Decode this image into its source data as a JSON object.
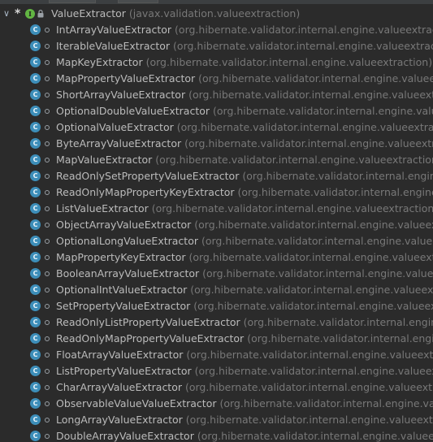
{
  "root": {
    "name": "ValueExtractor",
    "package": "(javax.validation.valueextraction)"
  },
  "items": [
    {
      "name": "IntArrayValueExtractor",
      "package": "(org.hibernate.validator.internal.engine.valueextraction)"
    },
    {
      "name": "IterableValueExtractor",
      "package": "(org.hibernate.validator.internal.engine.valueextraction)"
    },
    {
      "name": "MapKeyExtractor",
      "package": "(org.hibernate.validator.internal.engine.valueextraction)"
    },
    {
      "name": "MapPropertyValueExtractor",
      "package": "(org.hibernate.validator.internal.engine.valueextract"
    },
    {
      "name": "ShortArrayValueExtractor",
      "package": "(org.hibernate.validator.internal.engine.valueextraction"
    },
    {
      "name": "OptionalDoubleValueExtractor",
      "package": "(org.hibernate.validator.internal.engine.valueextr"
    },
    {
      "name": "OptionalValueExtractor",
      "package": "(org.hibernate.validator.internal.engine.valueextraction)"
    },
    {
      "name": "ByteArrayValueExtractor",
      "package": "(org.hibernate.validator.internal.engine.valueextraction)"
    },
    {
      "name": "MapValueExtractor",
      "package": "(org.hibernate.validator.internal.engine.valueextraction)"
    },
    {
      "name": "ReadOnlySetPropertyValueExtractor",
      "package": "(org.hibernate.validator.internal.engine.valu"
    },
    {
      "name": "ReadOnlyMapPropertyKeyExtractor",
      "package": "(org.hibernate.validator.internal.engine.valu"
    },
    {
      "name": "ListValueExtractor",
      "package": "(org.hibernate.validator.internal.engine.valueextraction)"
    },
    {
      "name": "ObjectArrayValueExtractor",
      "package": "(org.hibernate.validator.internal.engine.valueextractio"
    },
    {
      "name": "OptionalLongValueExtractor",
      "package": "(org.hibernate.validator.internal.engine.valueextrac"
    },
    {
      "name": "MapPropertyKeyExtractor",
      "package": "(org.hibernate.validator.internal.engine.valueextractio"
    },
    {
      "name": "BooleanArrayValueExtractor",
      "package": "(org.hibernate.validator.internal.engine.valueextrac"
    },
    {
      "name": "OptionalIntValueExtractor",
      "package": "(org.hibernate.validator.internal.engine.valueextractio"
    },
    {
      "name": "SetPropertyValueExtractor",
      "package": "(org.hibernate.validator.internal.engine.valueextractio"
    },
    {
      "name": "ReadOnlyListPropertyValueExtractor",
      "package": "(org.hibernate.validator.internal.engine.valu"
    },
    {
      "name": "ReadOnlyMapPropertyValueExtractor",
      "package": "(org.hibernate.validator.internal.engine.valu"
    },
    {
      "name": "FloatArrayValueExtractor",
      "package": "(org.hibernate.validator.internal.engine.valueextraction"
    },
    {
      "name": "ListPropertyValueExtractor",
      "package": "(org.hibernate.validator.internal.engine.valueextractio"
    },
    {
      "name": "CharArrayValueExtractor",
      "package": "(org.hibernate.validator.internal.engine.valueextraction"
    },
    {
      "name": "ObservableValueValueExtractor",
      "package": "(org.hibernate.validator.internal.engine.valueext"
    },
    {
      "name": "LongArrayValueExtractor",
      "package": "(org.hibernate.validator.internal.engine.valueextraction"
    },
    {
      "name": "DoubleArrayValueExtractor",
      "package": "(org.hibernate.validator.internal.engine.valueextractio"
    }
  ],
  "icons": {
    "expand": "chevron-down-icon",
    "marker": "asterisk",
    "interface": "interface-icon",
    "lock": "lock-icon",
    "class": "class-icon",
    "visibility": "package-private-icon"
  },
  "colors": {
    "background": "#2b2b2b",
    "class_name": "#bbbbbb",
    "package": "#787878",
    "class_icon": "#3d8eb9",
    "interface_icon": "#62b543"
  }
}
